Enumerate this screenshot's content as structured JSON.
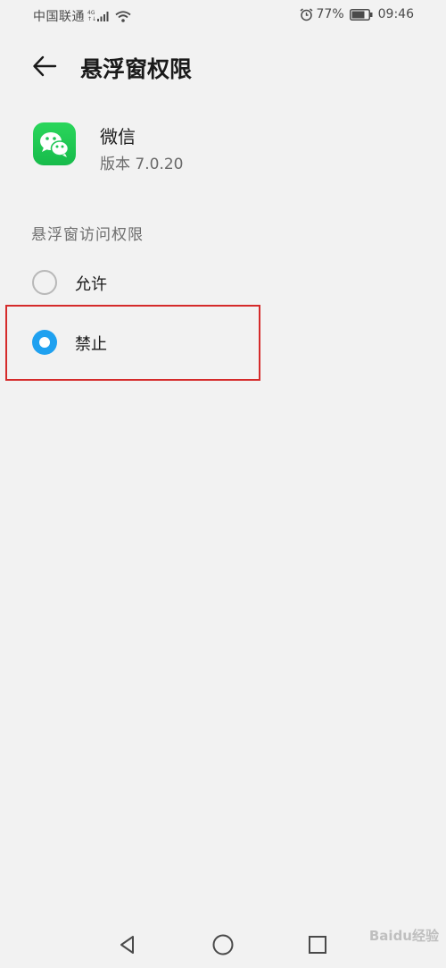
{
  "status_bar": {
    "carrier": "中国联通",
    "network_type_top": "4G",
    "network_type_bottom": "↑↓",
    "battery_percent": "77%",
    "time": "09:46"
  },
  "header": {
    "title": "悬浮窗权限"
  },
  "app": {
    "name": "微信",
    "version": "版本 7.0.20"
  },
  "permission": {
    "section_title": "悬浮窗访问权限",
    "options": [
      {
        "label": "允许",
        "selected": false
      },
      {
        "label": "禁止",
        "selected": true
      }
    ]
  },
  "colors": {
    "accent": "#1fa1f0",
    "highlight_border": "#d52b2b",
    "wechat_green": "#1fc656"
  },
  "icons": {
    "back": "arrow-left-icon",
    "alarm": "alarm-icon",
    "battery": "battery-icon",
    "wifi": "wifi-icon",
    "signal": "signal-icon",
    "nav_back": "triangle-back-icon",
    "nav_home": "circle-home-icon",
    "nav_recent": "square-recent-icon"
  },
  "watermark": "Baidu经验"
}
